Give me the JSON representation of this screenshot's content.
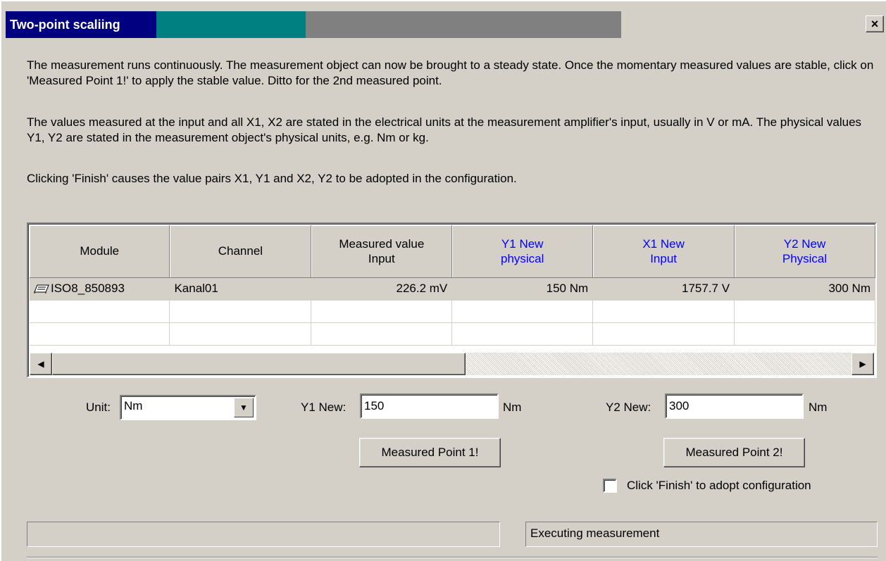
{
  "window": {
    "title": "Two-point scaliing",
    "close_label": "×"
  },
  "info": {
    "p1": "The measurement runs continuously. The measurement object can now be brought to a steady state. Once the momentary measured values are stable, click on 'Measured Point 1!' to apply the stable value. Ditto for the 2nd measured point.",
    "p2": "The values measured at the input and all X1, X2 are stated in the electrical units at the measurement amplifier's input, usually in V or mA. The physical values Y1, Y2 are stated in the measurement object's physical units, e.g. Nm or kg.",
    "p3": "Clicking 'Finish' causes the value pairs X1, Y1 and X2, Y2 to be adopted in the configuration."
  },
  "grid": {
    "columns": [
      {
        "line1": "Module",
        "line2": "",
        "blue": false
      },
      {
        "line1": "Channel",
        "line2": "",
        "blue": false
      },
      {
        "line1": "Measured value",
        "line2": "Input",
        "blue": false
      },
      {
        "line1": "Y1 New",
        "line2": "physical",
        "blue": true
      },
      {
        "line1": "X1 New",
        "line2": "Input",
        "blue": true
      },
      {
        "line1": "Y2 New",
        "line2": "Physical",
        "blue": true
      }
    ],
    "rows": [
      {
        "module": "ISO8_850893",
        "channel": "Kanal01",
        "measured": "226.2 mV",
        "y1": "150 Nm",
        "x1": "1757.7 V",
        "y2": "300 Nm"
      }
    ],
    "empty_rows": 2
  },
  "controls": {
    "unit_label": "Unit:",
    "unit_value": "Nm",
    "y1_label": "Y1 New:",
    "y1_value": "150",
    "y1_unit": "Nm",
    "y2_label": "Y2 New:",
    "y2_value": "300",
    "y2_unit": "Nm",
    "point1_button": "Measured Point 1!",
    "point2_button": "Measured Point 2!",
    "adopt_checkbox_label": "Click 'Finish' to adopt configuration",
    "adopt_checked": false
  },
  "status": {
    "left": "",
    "right": "Executing measurement"
  },
  "colors": {
    "title_dark": "#000080",
    "title_teal": "#008080",
    "header_blue": "#0000ff",
    "face": "#d4d0c8"
  }
}
